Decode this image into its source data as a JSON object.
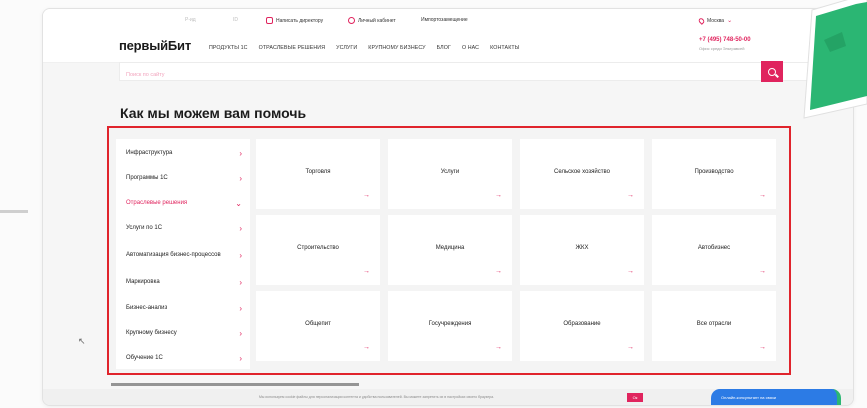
{
  "topbar": {
    "faint1": "Р-ид",
    "faint2": "ID",
    "write_director": "Написать директору",
    "cabinet": "Личный кабинет",
    "import": "Импортозамещение",
    "city": "Москва"
  },
  "header": {
    "logo": "первыйБит",
    "nav": [
      "ПРОДУКТЫ 1С",
      "ОТРАСЛЕВЫЕ РЕШЕНИЯ",
      "УСЛУГИ",
      "КРУПНОМУ БИЗНЕСУ",
      "БЛОГ",
      "О НАС",
      "КОНТАКТЫ"
    ],
    "phone": "+7 (495) 748-50-00",
    "phone_sub": "Офис среди Эльтравсей"
  },
  "search": {
    "placeholder": "Поиск по сайту"
  },
  "title": "Как мы можем вам помочь",
  "sidebar": {
    "items": [
      {
        "label": "Инфраструктура",
        "chevron": "›"
      },
      {
        "label": "Программы 1С",
        "chevron": "›"
      },
      {
        "label": "Отраслевые решения",
        "chevron": "⌄"
      },
      {
        "label": "Услуги по 1С",
        "chevron": "›"
      },
      {
        "label": "Автоматизация бизнес-процессов",
        "chevron": "›"
      },
      {
        "label": "Маркировка",
        "chevron": "›"
      },
      {
        "label": "Бизнес-анализ",
        "chevron": "›"
      },
      {
        "label": "Крупному бизнесу",
        "chevron": "›"
      },
      {
        "label": "Обучение 1С",
        "chevron": "›"
      }
    ]
  },
  "tiles": [
    {
      "label": "Торговля",
      "arrow": "→"
    },
    {
      "label": "Услуги",
      "arrow": "→"
    },
    {
      "label": "Сельское хозяйство",
      "arrow": "→"
    },
    {
      "label": "Производство",
      "arrow": "→"
    },
    {
      "label": "Строительство",
      "arrow": "→"
    },
    {
      "label": "Медицина",
      "arrow": "→"
    },
    {
      "label": "ЖКХ",
      "arrow": "→"
    },
    {
      "label": "Автобизнес",
      "arrow": "→"
    },
    {
      "label": "Общепит",
      "arrow": "→"
    },
    {
      "label": "Госучреждения",
      "arrow": "→"
    },
    {
      "label": "Образование",
      "arrow": "→"
    },
    {
      "label": "Все отрасли",
      "arrow": "→"
    }
  ],
  "cookie": {
    "text": "Мы используем cookie файлы для персонализации контента и удобства пользователей. Вы можете запретить их в настройках своего браузера.",
    "ok": "Ок"
  },
  "consult": "Онлайн-консультант на связи",
  "cursor_glyph": "↖",
  "colors": {
    "accent": "#e0245e",
    "highlight_border": "#e0242c",
    "badge_green": "#2bb673",
    "consult_blue": "#2c7be5"
  },
  "icons": [
    "pencil-icon",
    "user-icon",
    "pin-icon",
    "search-icon",
    "chevron-right-icon",
    "arrow-right-icon",
    "thumbs-up-icon",
    "mouse-cursor-icon"
  ]
}
